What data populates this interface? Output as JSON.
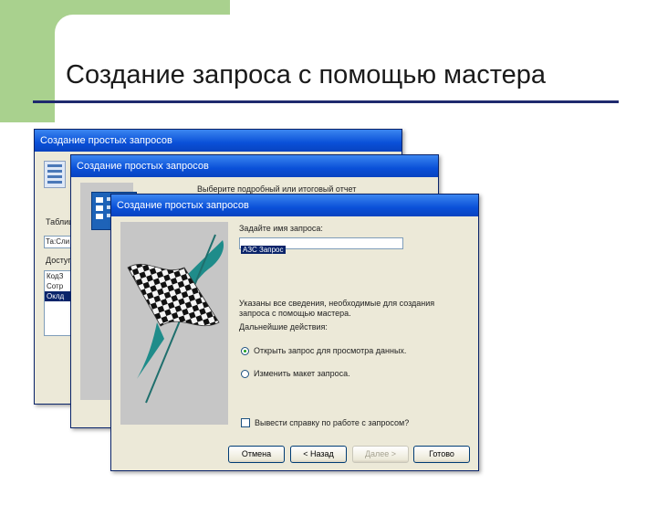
{
  "slide": {
    "title": "Создание запроса с помощью мастера"
  },
  "windows": {
    "back": {
      "title": "Создание простых запросов",
      "tables_label": "Таблиц",
      "table_select": "Та:Сли",
      "fields_label": "Доступ",
      "fields": [
        "КодЗ",
        "Сотр",
        "Оклд"
      ]
    },
    "middle": {
      "title": "Создание простых запросов",
      "prompt": "Выберите подробный или итоговый отчет"
    },
    "front": {
      "title": "Создание простых запросов",
      "name_label": "Задайте имя запроса:",
      "name_value": "АЗС Запрос",
      "info_line1": "Указаны все сведения, необходимые для создания",
      "info_line2": "запроса с помощью мастера.",
      "next_actions_label": "Дальнейшие действия:",
      "option_open": "Открыть запрос для просмотра данных.",
      "option_edit": "Изменить макет запроса.",
      "help_checkbox": "Вывести справку по работе с запросом?",
      "buttons": {
        "cancel": "Отмена",
        "back": "< Назад",
        "next": "Далее >",
        "finish": "Готово"
      }
    }
  },
  "colors": {
    "title_bar": "#0a50d8",
    "window_bg": "#ece9d8",
    "accent_green": "#a9d18e",
    "title_rule": "#1f2a6e"
  }
}
